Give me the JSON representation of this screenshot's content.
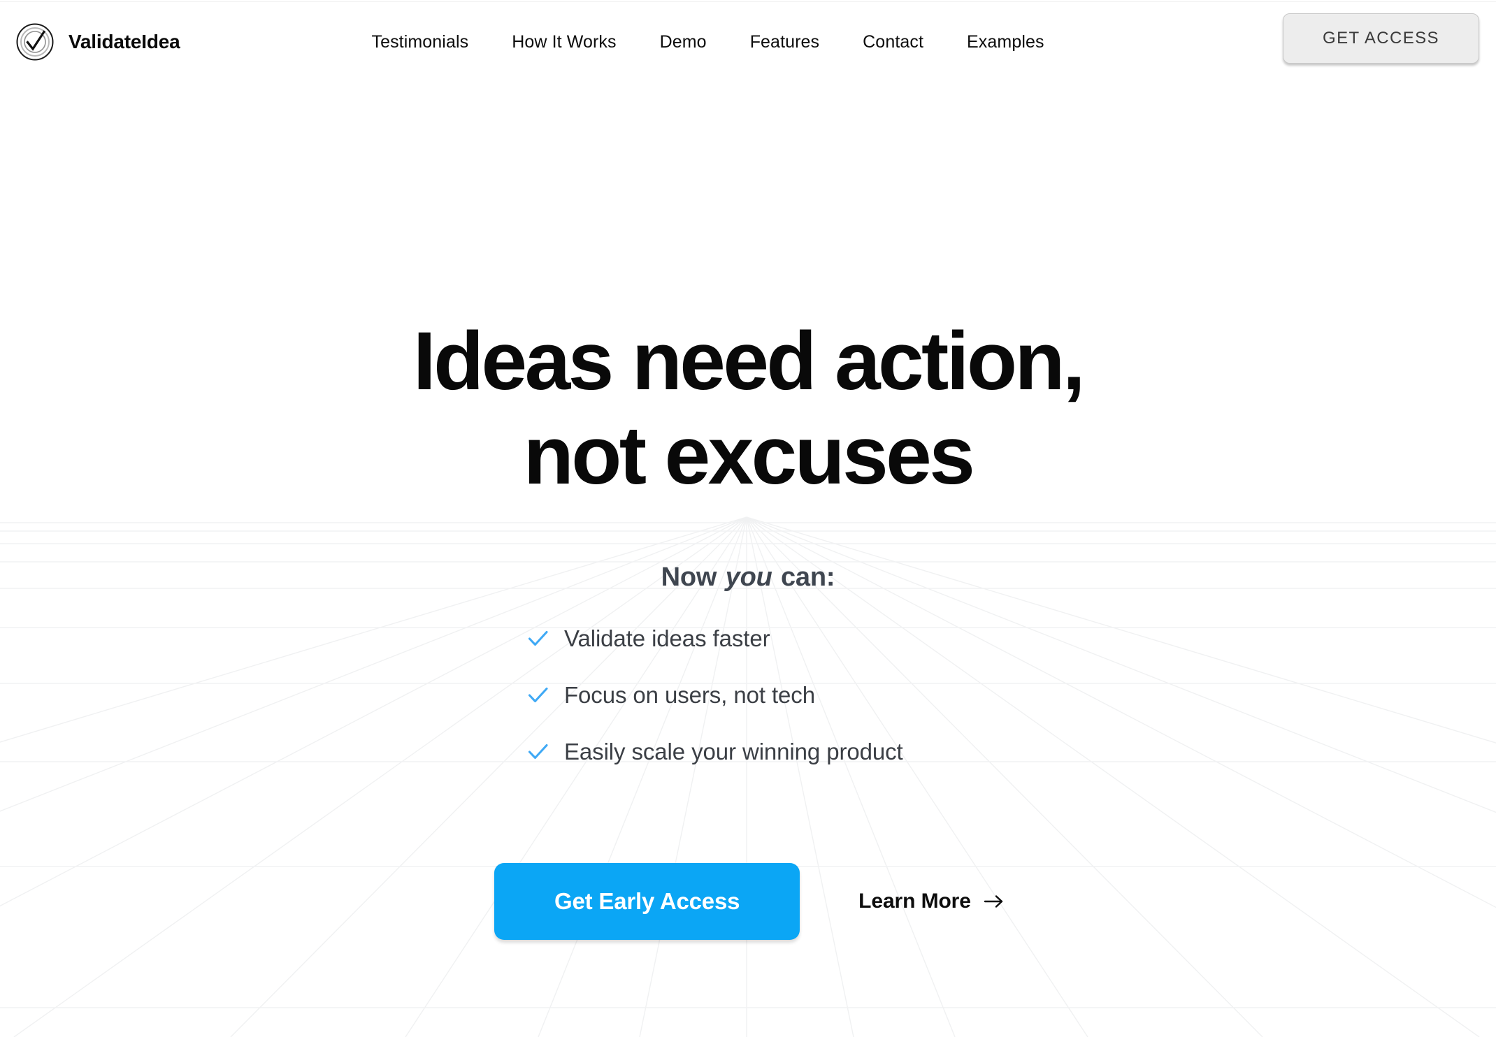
{
  "brand": {
    "name": "ValidateIdea",
    "logo_icon": "check-circle-icon"
  },
  "nav": {
    "items": [
      {
        "label": "Testimonials"
      },
      {
        "label": "How It Works"
      },
      {
        "label": "Demo"
      },
      {
        "label": "Features"
      },
      {
        "label": "Contact"
      },
      {
        "label": "Examples"
      }
    ],
    "cta_label": "GET ACCESS"
  },
  "hero": {
    "headline_line1": "Ideas need action,",
    "headline_line2": "not excuses",
    "subhead_prefix": "Now ",
    "subhead_emphasis": "you",
    "subhead_suffix": " can:",
    "checklist": [
      {
        "icon": "check-icon",
        "label": "Validate ideas faster"
      },
      {
        "icon": "check-icon",
        "label": "Focus on users, not tech"
      },
      {
        "icon": "check-icon",
        "label": "Easily scale your winning product"
      }
    ],
    "primary_cta_label": "Get Early Access",
    "secondary_cta_label": "Learn More",
    "secondary_cta_icon": "arrow-right-icon"
  },
  "colors": {
    "accent_blue": "#0ba6f5",
    "check_blue": "#3fa9f5",
    "headline": "#090909",
    "body_text": "#3b3f45",
    "button_gray": "#ededed",
    "grid_line": "#f0f1f2"
  }
}
